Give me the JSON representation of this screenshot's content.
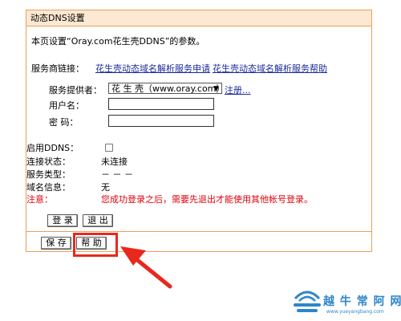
{
  "panel": {
    "title": "动态DNS设置",
    "intro": "本页设置“Oray.com花生壳DDNS”的参数。",
    "service_links_label": "服务商链接：",
    "link_apply": "花生壳动态域名解析服务申请",
    "link_help": "花生壳动态域名解析服务帮助",
    "provider_label": "服务提供者：",
    "provider_value": "花 生 壳（www.oray.com）",
    "register_link": "注册...",
    "username_label": "用户名：",
    "username_value": "",
    "password_label": "密  码：",
    "password_value": "",
    "enable_ddns_label": "启用DDNS：",
    "enable_ddns_checked": false,
    "conn_status_label": "连接状态：",
    "conn_status_value": "未连接",
    "service_type_label": "服务类型：",
    "service_type_value": "－ － －",
    "domain_info_label": "域名信息：",
    "domain_info_value": "无",
    "notice_label": "注意：",
    "notice_text": "您成功登录之后，需要先退出才能使用其他帐号登录。",
    "login_button": "登 录",
    "logout_button": "退 出",
    "save_button": "保 存",
    "help_button": "帮 助"
  },
  "watermark": {
    "text": "越 牛 常 阿 网",
    "url": "www.yueyangbang.com"
  },
  "colors": {
    "title_bg": "#fde8d3",
    "border": "#e9a15a",
    "link": "#1a2a9c",
    "notice": "#e0000b",
    "annotation_red": "#e8281c",
    "watermark": "#2e86c9"
  }
}
